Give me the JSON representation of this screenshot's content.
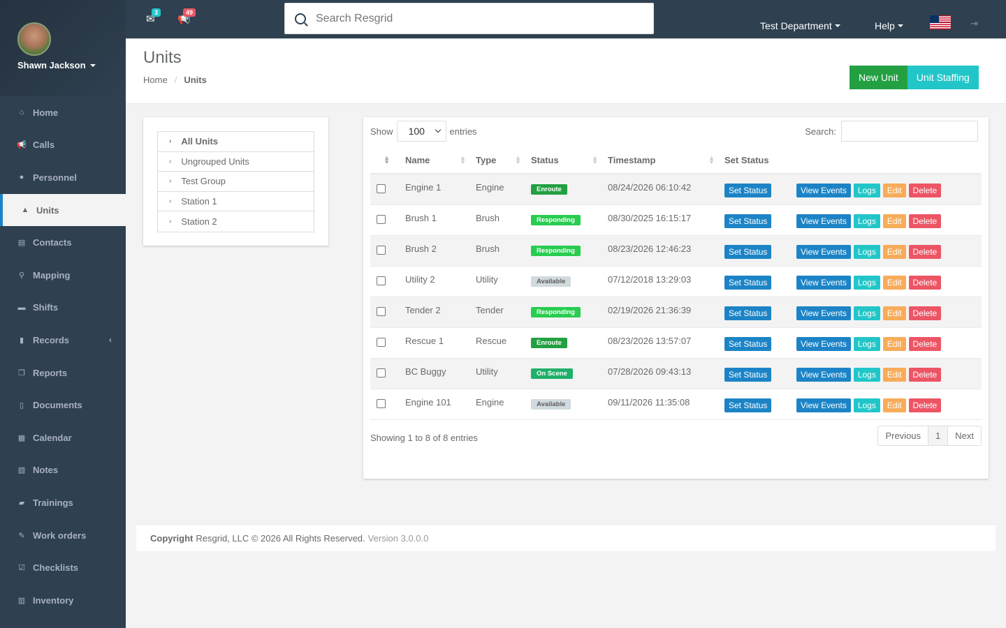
{
  "user": {
    "name": "Shawn Jackson"
  },
  "sidebar": {
    "items": [
      {
        "label": "Home",
        "icon": "home-icon"
      },
      {
        "label": "Calls",
        "icon": "bullhorn-icon"
      },
      {
        "label": "Personnel",
        "icon": "user-icon"
      },
      {
        "label": "Units",
        "icon": "truck-icon"
      },
      {
        "label": "Contacts",
        "icon": "address-book-icon"
      },
      {
        "label": "Mapping",
        "icon": "map-marker-icon"
      },
      {
        "label": "Shifts",
        "icon": "briefcase-icon"
      },
      {
        "label": "Records",
        "icon": "file-icon"
      },
      {
        "label": "Reports",
        "icon": "copy-icon"
      },
      {
        "label": "Documents",
        "icon": "document-icon"
      },
      {
        "label": "Calendar",
        "icon": "calendar-icon"
      },
      {
        "label": "Notes",
        "icon": "notes-icon"
      },
      {
        "label": "Trainings",
        "icon": "graduation-icon"
      },
      {
        "label": "Work orders",
        "icon": "wrench-icon"
      },
      {
        "label": "Checklists",
        "icon": "checklist-icon"
      },
      {
        "label": "Inventory",
        "icon": "barcode-icon"
      }
    ]
  },
  "topbar": {
    "messages_count": "3",
    "calls_count": "49",
    "search_placeholder": "Search Resgrid",
    "department": "Test Department",
    "help": "Help"
  },
  "page": {
    "title": "Units",
    "breadcrumb_home": "Home",
    "breadcrumb_current": "Units",
    "new_unit": "New Unit",
    "unit_staffing": "Unit Staffing"
  },
  "tree": {
    "items": [
      "All Units",
      "Ungrouped Units",
      "Test Group",
      "Station 1",
      "Station 2"
    ]
  },
  "table": {
    "show_label": "Show",
    "entries_label": "entries",
    "page_size": "100",
    "search_label": "Search:",
    "columns": [
      "Name",
      "Type",
      "Status",
      "Timestamp",
      "Set Status"
    ],
    "rows": [
      {
        "name": "Engine 1",
        "type": "Engine",
        "status": "Enroute",
        "timestamp": "08/24/2026 06:10:42"
      },
      {
        "name": "Brush 1",
        "type": "Brush",
        "status": "Responding",
        "timestamp": "08/30/2025 16:15:17"
      },
      {
        "name": "Brush 2",
        "type": "Brush",
        "status": "Responding",
        "timestamp": "08/23/2026 12:46:23"
      },
      {
        "name": "Utility 2",
        "type": "Utility",
        "status": "Available",
        "timestamp": "07/12/2018 13:29:03"
      },
      {
        "name": "Tender 2",
        "type": "Tender",
        "status": "Responding",
        "timestamp": "02/19/2026 21:36:39"
      },
      {
        "name": "Rescue 1",
        "type": "Rescue",
        "status": "Enroute",
        "timestamp": "08/23/2026 13:57:07"
      },
      {
        "name": "BC Buggy",
        "type": "Utility",
        "status": "On Scene",
        "timestamp": "07/28/2026 09:43:13"
      },
      {
        "name": "Engine 101",
        "type": "Engine",
        "status": "Available",
        "timestamp": "09/11/2026 11:35:08"
      }
    ],
    "btn_set_status": "Set Status",
    "btn_view_events": "View Events",
    "btn_logs": "Logs",
    "btn_edit": "Edit",
    "btn_delete": "Delete",
    "showing": "Showing 1 to 8 of 8 entries",
    "prev": "Previous",
    "page_num": "1",
    "next": "Next"
  },
  "footer": {
    "copyright_label": "Copyright",
    "copyright_text": "Resgrid, LLC © 2026 All Rights Reserved.",
    "version": "Version 3.0.0.0"
  }
}
